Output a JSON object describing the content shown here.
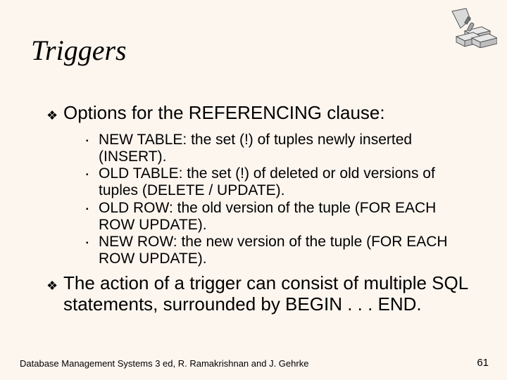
{
  "title": "Triggers",
  "points": [
    "Options for the REFERENCING clause:",
    "The action of a trigger can consist of multiple SQL statements, surrounded by BEGIN . . . END."
  ],
  "subpoints": [
    "NEW TABLE: the set (!) of tuples newly inserted (INSERT).",
    "OLD TABLE: the set (!) of deleted or old versions of tuples (DELETE / UPDATE).",
    "OLD ROW: the old version of the tuple (FOR EACH ROW UPDATE).",
    "NEW ROW: the new version of the tuple (FOR EACH ROW UPDATE)."
  ],
  "footer": "Database Management Systems 3 ed,  R. Ramakrishnan and J. Gehrke",
  "page_number": "61",
  "icons": {
    "diamond_bullet": "diamond-bullet-icon",
    "square_bullet": "square-bullet-icon",
    "corner": "bricks-trowel-icon"
  }
}
